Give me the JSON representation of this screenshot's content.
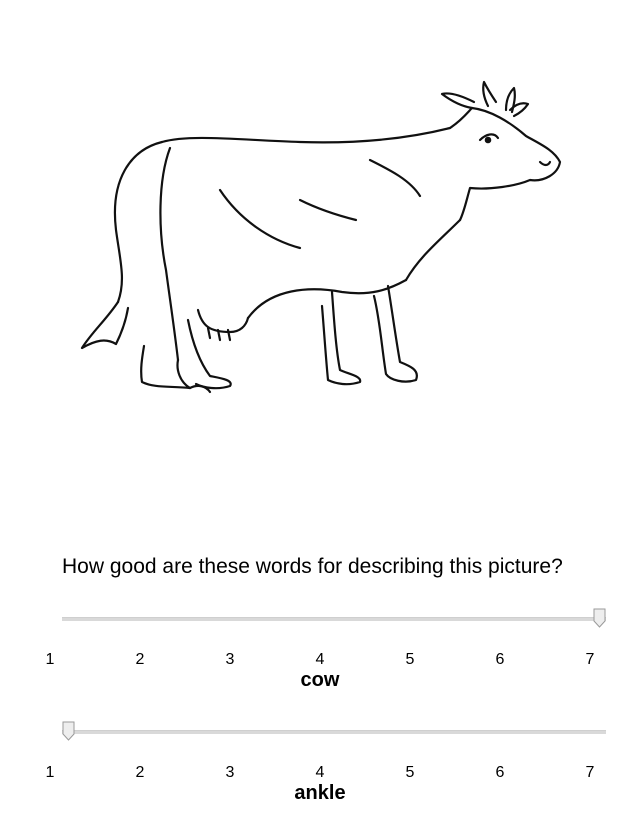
{
  "image": {
    "subject": "cow-line-drawing"
  },
  "question": "How good are these words for describing this picture?",
  "scale": {
    "min": 1,
    "max": 7,
    "ticks": [
      "1",
      "2",
      "3",
      "4",
      "5",
      "6",
      "7"
    ]
  },
  "items": [
    {
      "word": "cow",
      "value": 7
    },
    {
      "word": "ankle",
      "value": 1
    }
  ]
}
